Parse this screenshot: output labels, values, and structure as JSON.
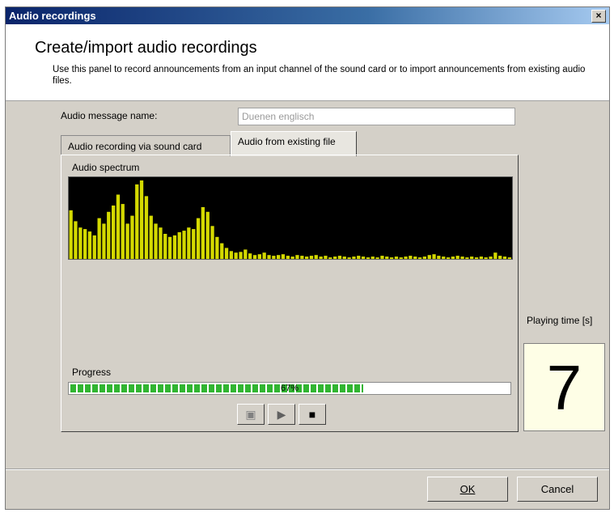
{
  "window": {
    "title": "Audio recordings",
    "close_glyph": "×"
  },
  "header": {
    "title": "Create/import audio recordings",
    "description": "Use this panel to record announcements from an input channel of the sound card or to import announcements from existing audio files."
  },
  "form": {
    "name_label": "Audio message name:",
    "name_value": "Duenen englisch"
  },
  "tabs": [
    {
      "label": "Audio recording via sound card",
      "active": false
    },
    {
      "label": "Audio from existing file",
      "active": true
    }
  ],
  "panel": {
    "spectrum_label": "Audio spectrum",
    "progress_label": "Progress",
    "progress_text": "67%",
    "progress_value": 0.67,
    "spectrum_levels": [
      0.62,
      0.48,
      0.4,
      0.38,
      0.35,
      0.3,
      0.52,
      0.45,
      0.6,
      0.68,
      0.82,
      0.7,
      0.45,
      0.55,
      0.95,
      1.0,
      0.8,
      0.55,
      0.45,
      0.4,
      0.32,
      0.28,
      0.3,
      0.34,
      0.36,
      0.4,
      0.38,
      0.52,
      0.66,
      0.6,
      0.42,
      0.28,
      0.2,
      0.14,
      0.1,
      0.08,
      0.09,
      0.12,
      0.07,
      0.05,
      0.06,
      0.08,
      0.05,
      0.04,
      0.05,
      0.06,
      0.04,
      0.03,
      0.05,
      0.04,
      0.03,
      0.04,
      0.05,
      0.03,
      0.04,
      0.02,
      0.03,
      0.04,
      0.03,
      0.02,
      0.03,
      0.04,
      0.03,
      0.02,
      0.03,
      0.02,
      0.04,
      0.03,
      0.02,
      0.03,
      0.02,
      0.03,
      0.04,
      0.03,
      0.02,
      0.03,
      0.05,
      0.06,
      0.04,
      0.03,
      0.02,
      0.03,
      0.04,
      0.03,
      0.02,
      0.03,
      0.02,
      0.03,
      0.02,
      0.03,
      0.08,
      0.04,
      0.03,
      0.02
    ],
    "spectrum_color": "#d4d900",
    "buttons": [
      {
        "name": "open-file-button",
        "icon": "folder-icon",
        "glyph": "▣"
      },
      {
        "name": "play-button",
        "icon": "play-icon",
        "glyph": "▶"
      },
      {
        "name": "stop-button",
        "icon": "stop-icon",
        "glyph": "■"
      }
    ]
  },
  "playing_time": {
    "label": "Playing time [s]",
    "value": "7"
  },
  "footer": {
    "ok_label": "OK",
    "cancel_label": "Cancel"
  }
}
